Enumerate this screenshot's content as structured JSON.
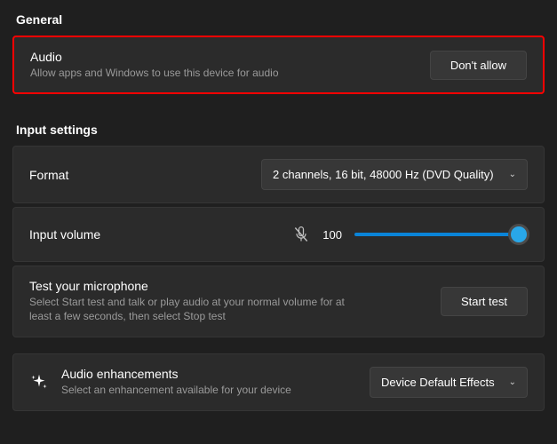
{
  "general": {
    "header": "General",
    "audio": {
      "title": "Audio",
      "subtitle": "Allow apps and Windows to use this device for audio",
      "button": "Don't allow"
    }
  },
  "input": {
    "header": "Input settings",
    "format": {
      "label": "Format",
      "value": "2 channels, 16 bit, 48000 Hz (DVD Quality)"
    },
    "volume": {
      "label": "Input volume",
      "value": "100"
    },
    "test": {
      "title": "Test your microphone",
      "subtitle": "Select Start test and talk or play audio at your normal volume for at least a few seconds, then select Stop test",
      "button": "Start test"
    },
    "enhancements": {
      "title": "Audio enhancements",
      "subtitle": "Select an enhancement available for your device",
      "value": "Device Default Effects"
    }
  }
}
